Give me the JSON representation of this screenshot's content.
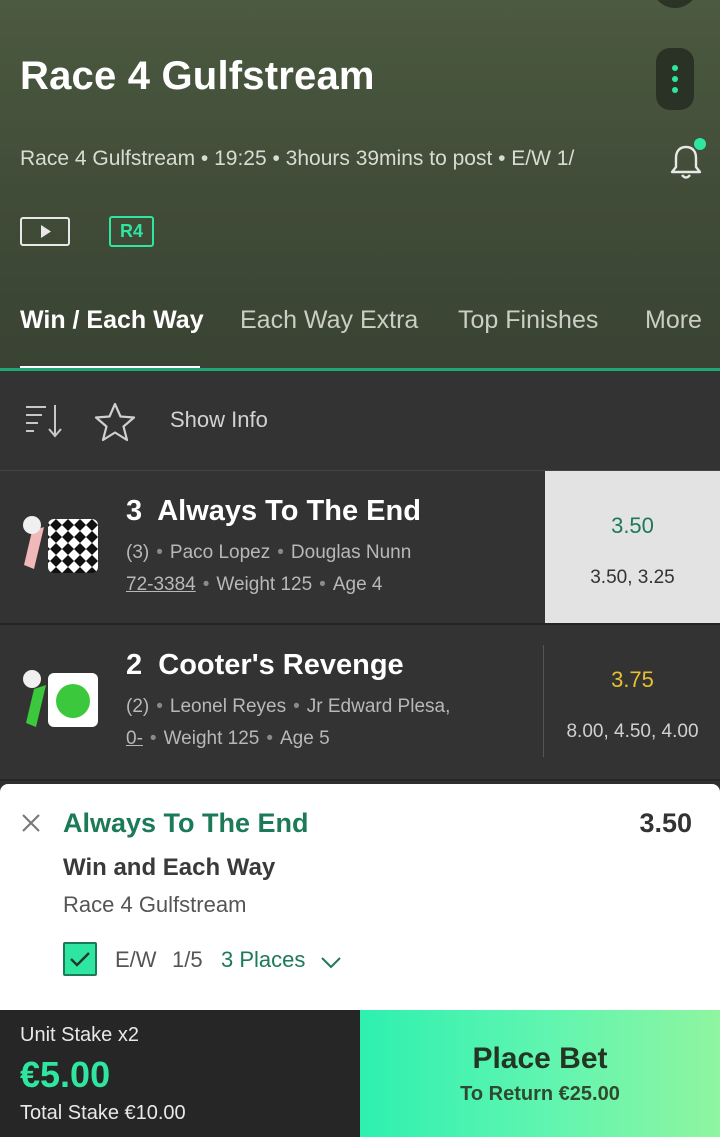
{
  "header": {
    "title": "Race 4 Gulfstream",
    "meta": "Race 4 Gulfstream • 19:25 • 3hours 39mins to post • E/W 1/",
    "badge": "R4",
    "accent_color": "#2ee6a0",
    "icons": [
      "more-vertical-icon",
      "bell-icon",
      "play-icon"
    ]
  },
  "tabs": [
    {
      "label": "Win / Each Way",
      "active": true
    },
    {
      "label": "Each Way Extra",
      "active": false
    },
    {
      "label": "Top Finishes",
      "active": false
    },
    {
      "label": "More",
      "active": false
    }
  ],
  "toolbar": {
    "show_info": "Show Info",
    "icons": [
      "sort-icon",
      "star-icon"
    ]
  },
  "runners": [
    {
      "number": "3",
      "name": "Always To The End",
      "draw": "(3)",
      "jockey": "Paco Lopez",
      "trainer": "Douglas Nunn",
      "form": "72-3384",
      "weight": "Weight 125",
      "age": "Age 4",
      "odds": "3.50",
      "odds_history": "3.50, 3.25",
      "odds_color": "#1c7a58",
      "selected": true
    },
    {
      "number": "2",
      "name": "Cooter's Revenge",
      "draw": "(2)",
      "jockey": "Leonel Reyes",
      "trainer": "Jr Edward Plesa,",
      "form": "0-",
      "weight": "Weight 125",
      "age": "Age 5",
      "odds": "3.75",
      "odds_history": "8.00, 4.50, 4.00",
      "odds_color": "#e6c030",
      "selected": false
    }
  ],
  "betslip": {
    "selection": "Always To The End",
    "odds": "3.50",
    "market": "Win and Each Way",
    "event": "Race 4 Gulfstream",
    "ew_checked": true,
    "ew_label": "E/W",
    "ew_terms": "1/5",
    "places": "3 Places"
  },
  "footer": {
    "unit_stake": "Unit Stake x2",
    "stake": "€5.00",
    "total_stake": "Total Stake  €10.00",
    "place_bet": "Place Bet",
    "to_return": "To Return €25.00"
  }
}
